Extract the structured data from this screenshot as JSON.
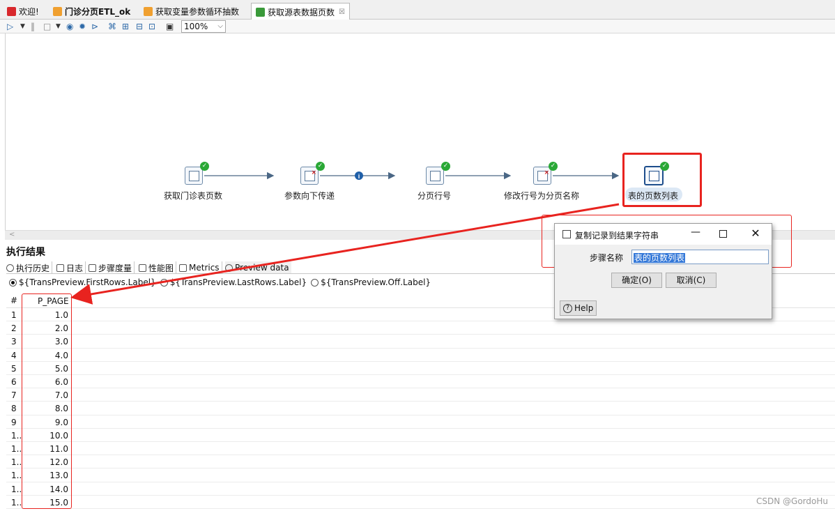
{
  "tabs": [
    {
      "label": "欢迎!",
      "color": "#d8282c",
      "bold": false
    },
    {
      "label": "门诊分页ETL_ok",
      "color": "#f0a030",
      "bold": true
    },
    {
      "label": "获取变量参数循环抽数",
      "color": "#f0a030",
      "bold": false
    },
    {
      "label": "获取源表数据页数",
      "color": "#3a9a3a",
      "bold": false,
      "active": true,
      "close": "☒"
    }
  ],
  "toolbar": {
    "icons": [
      "run-icon",
      "dropdown-icon",
      "pause-icon",
      "stop-icon",
      "dropdown-icon",
      "preview-icon",
      "debug-icon",
      "replay-icon",
      "verify-icon",
      "impact-icon",
      "sql-icon",
      "explore-db-icon",
      "snap-grid-icon"
    ],
    "zoom": "100%"
  },
  "steps": [
    {
      "label": "获取门诊表页数",
      "icon": "table-input-icon"
    },
    {
      "label": "参数向下传递",
      "icon": "select-values-icon"
    },
    {
      "label": "分页行号",
      "icon": "table-input-icon"
    },
    {
      "label": "修改行号为分页名称",
      "icon": "select-values-icon"
    },
    {
      "label": "表的页数列表",
      "icon": "copy-rows-to-result-icon"
    }
  ],
  "hops": [
    "arrow",
    "arrow-info",
    "arrow",
    "arrow"
  ],
  "results": {
    "title": "执行结果",
    "tabs": [
      "执行历史",
      "日志",
      "步骤度量",
      "性能图",
      "Metrics",
      "Preview data"
    ],
    "radios": [
      "${TransPreview.FirstRows.Label}",
      "${TransPreview.LastRows.Label}",
      "${TransPreview.Off.Label}"
    ],
    "columns": [
      "#",
      "P_PAGE"
    ],
    "rows": [
      [
        "1",
        "1.0"
      ],
      [
        "2",
        "2.0"
      ],
      [
        "3",
        "3.0"
      ],
      [
        "4",
        "4.0"
      ],
      [
        "5",
        "5.0"
      ],
      [
        "6",
        "6.0"
      ],
      [
        "7",
        "7.0"
      ],
      [
        "8",
        "8.0"
      ],
      [
        "9",
        "9.0"
      ],
      [
        "1..",
        "10.0"
      ],
      [
        "1..",
        "11.0"
      ],
      [
        "1..",
        "12.0"
      ],
      [
        "1..",
        "13.0"
      ],
      [
        "1..",
        "14.0"
      ],
      [
        "1..",
        "15.0"
      ]
    ]
  },
  "dialog": {
    "title": "复制记录到结果字符串",
    "step_name_label": "步骤名称",
    "step_name_value": "表的页数列表",
    "ok": "确定(O)",
    "cancel": "取消(C)",
    "help": "Help"
  },
  "watermark": "CSDN @GordoHu",
  "colors": {
    "highlight": "#e8231f",
    "ok": "#2aa836",
    "hop": "#5b7a9a"
  }
}
